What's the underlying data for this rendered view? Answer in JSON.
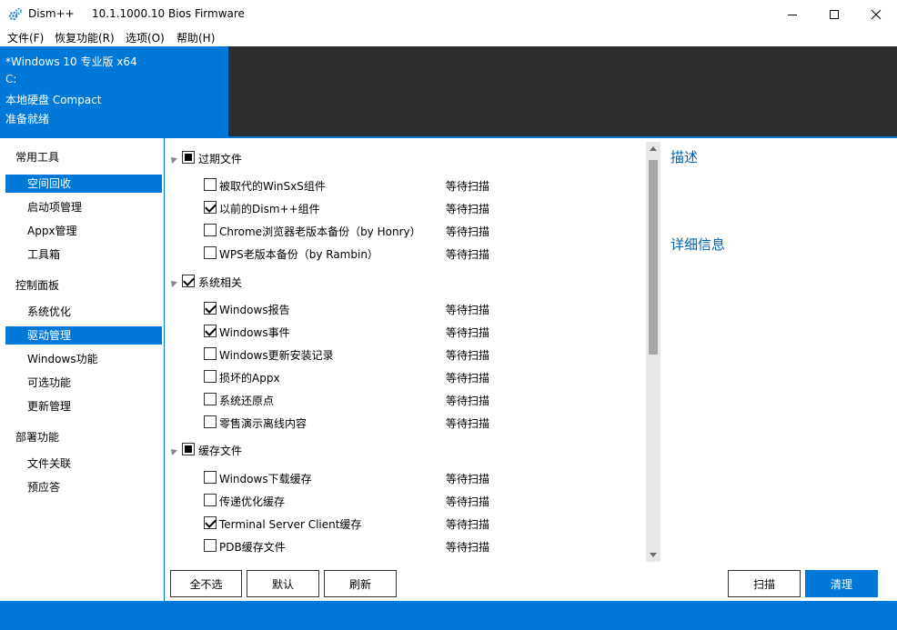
{
  "window": {
    "app_name": "Dism++",
    "version": "10.1.1000.10 Bios Firmware"
  },
  "menu": [
    "文件(F)",
    "恢复功能(R)",
    "选项(O)",
    "帮助(H)"
  ],
  "system": {
    "os": "*Windows 10 专业版 x64",
    "drive": "C:",
    "disk": "本地硬盘 Compact",
    "status": "准备就绪"
  },
  "sidebar": {
    "categories": [
      {
        "label": "常用工具",
        "items": [
          "空间回收",
          "启动项管理",
          "Appx管理",
          "工具箱"
        ]
      },
      {
        "label": "控制面板",
        "items": [
          "系统优化",
          "驱动管理",
          "Windows功能",
          "可选功能",
          "更新管理"
        ]
      },
      {
        "label": "部署功能",
        "items": [
          "文件关联",
          "预应答"
        ]
      }
    ],
    "selected": [
      "空间回收",
      "驱动管理"
    ]
  },
  "cleanup": {
    "groups": [
      {
        "label": "过期文件",
        "state": "partial",
        "items": [
          {
            "label": "被取代的WinSxS组件",
            "checked": false,
            "status": "等待扫描"
          },
          {
            "label": "以前的Dism++组件",
            "checked": true,
            "status": "等待扫描"
          },
          {
            "label": "Chrome浏览器老版本备份（by Honry）",
            "checked": false,
            "status": "等待扫描"
          },
          {
            "label": "WPS老版本备份（by Rambin）",
            "checked": false,
            "status": "等待扫描"
          }
        ]
      },
      {
        "label": "系统相关",
        "state": "checked",
        "items": [
          {
            "label": "Windows报告",
            "checked": true,
            "status": "等待扫描"
          },
          {
            "label": "Windows事件",
            "checked": true,
            "status": "等待扫描"
          },
          {
            "label": "Windows更新安装记录",
            "checked": false,
            "status": "等待扫描"
          },
          {
            "label": "损坏的Appx",
            "checked": false,
            "status": "等待扫描"
          },
          {
            "label": "系统还原点",
            "checked": false,
            "status": "等待扫描"
          },
          {
            "label": "零售演示离线内容",
            "checked": false,
            "status": "等待扫描"
          }
        ]
      },
      {
        "label": "缓存文件",
        "state": "partial",
        "items": [
          {
            "label": "Windows下载缓存",
            "checked": false,
            "status": "等待扫描"
          },
          {
            "label": "传递优化缓存",
            "checked": false,
            "status": "等待扫描"
          },
          {
            "label": "Terminal Server Client缓存",
            "checked": true,
            "status": "等待扫描"
          },
          {
            "label": "PDB缓存文件",
            "checked": false,
            "status": "等待扫描"
          }
        ]
      }
    ]
  },
  "details": {
    "description_label": "描述",
    "details_label": "详细信息"
  },
  "buttons": {
    "deselect_all": "全不选",
    "default": "默认",
    "refresh": "刷新",
    "scan": "扫描",
    "clean": "清理"
  },
  "colors": {
    "accent": "#0078d7",
    "header_dark": "#2d2d30",
    "link": "#0063b1"
  }
}
